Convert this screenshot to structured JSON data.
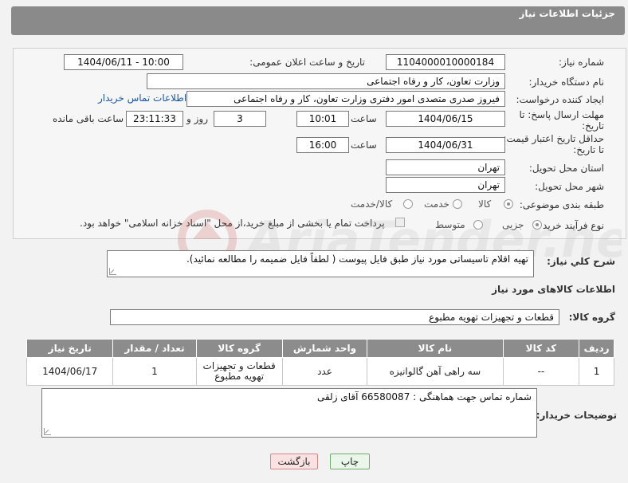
{
  "header": {
    "title": "جزئیات اطلاعات نیاز"
  },
  "form": {
    "need_number_label": "شماره نیاز:",
    "need_number": "1104000010000184",
    "announce_label": "تاریخ و ساعت اعلان عمومی:",
    "announce_value": "1404/06/11 - 10:00",
    "buyer_org_label": "نام دستگاه خریدار:",
    "buyer_org": "وزارت تعاون، کار و رفاه اجتماعی",
    "requester_label": "ایجاد کننده درخواست:",
    "requester": "فیروز صدری متصدی امور دفتری وزارت تعاون، کار و رفاه اجتماعی",
    "buyer_contact_link": "اطلاعات تماس خریدار",
    "deadline_label_1": "مهلت ارسال پاسخ: تا",
    "deadline_label_2": "تاریخ:",
    "deadline_date": "1404/06/15",
    "time_label": "ساعت",
    "deadline_time": "10:01",
    "days_value": "3",
    "days_label": "روز و",
    "remaining_time": "23:11:33",
    "remaining_label": "ساعت باقی مانده",
    "price_validity_label_1": "حداقل تاریخ اعتبار قیمت:",
    "price_validity_label_2": "تا تاریخ:",
    "price_validity_date": "1404/06/31",
    "price_validity_time": "16:00",
    "province_label": "استان محل تحویل:",
    "province": "تهران",
    "city_label": "شهر محل تحویل:",
    "city": "تهران",
    "category_label": "طبقه بندی موضوعی:",
    "category_options": [
      "کالا",
      "خدمت",
      "کالا/خدمت"
    ],
    "process_label": "نوع فرآیند خرید :",
    "process_options": [
      "جزیی",
      "متوسط"
    ],
    "payment_note": "پرداخت تمام یا بخشی از مبلغ خرید،از محل \"اسناد خزانه اسلامی\" خواهد بود."
  },
  "description": {
    "label": "شرح كلي نياز:",
    "text": "تهیه اقلام تاسیساتی مورد نیاز طبق فایل پیوست ( لطفاً فایل ضمیمه را مطالعه نمائید)."
  },
  "goods": {
    "section_title": "اطلاعات کالاهای مورد نیاز",
    "group_label": "گروه کالا:",
    "group_value": "قطعات و تجهیزات تهویه مطبوع",
    "columns": [
      "ردیف",
      "کد کالا",
      "نام کالا",
      "واحد شمارش",
      "گروه کالا",
      "تعداد / مقدار",
      "تاریخ نیاز"
    ],
    "rows": [
      {
        "index": "1",
        "code": "--",
        "name": "سه راهی آهن گالوانیزه",
        "unit": "عدد",
        "group": "قطعات و تجهیزات تهویه مطبوع",
        "qty": "1",
        "date": "1404/06/17"
      }
    ]
  },
  "buyer_notes": {
    "label": "توضیحات خریدار:",
    "text": "شماره تماس جهت هماهنگی : 66580087 آقای زلقی"
  },
  "buttons": {
    "print": "چاپ",
    "back": "بازگشت"
  },
  "watermark": {
    "text": "AriaTender.neT"
  },
  "colors": {
    "header": "#8a8a8a",
    "link": "#1a56a8",
    "print_bg": "#e9f6e9",
    "back_bg": "#fbe2e2"
  }
}
